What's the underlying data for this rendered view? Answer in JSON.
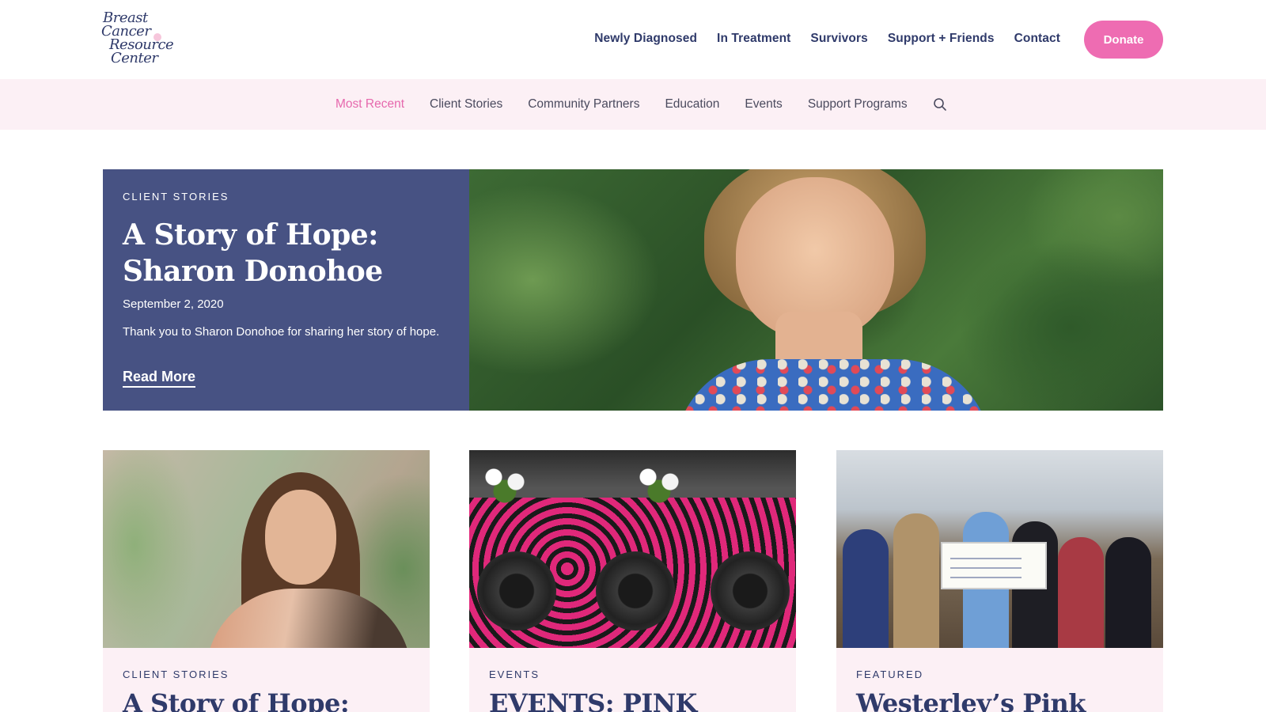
{
  "logo": {
    "lines": [
      "Breast",
      "Cancer",
      "Resource",
      "Center"
    ]
  },
  "main_nav": {
    "items": [
      "Newly Diagnosed",
      "In Treatment",
      "Survivors",
      "Support + Friends",
      "Contact"
    ],
    "donate_label": "Donate"
  },
  "sub_nav": {
    "items": [
      "Most Recent",
      "Client Stories",
      "Community Partners",
      "Education",
      "Events",
      "Support Programs"
    ],
    "active_index": 0,
    "search_icon": "search-icon"
  },
  "hero": {
    "category": "CLIENT STORIES",
    "title": "A Story of Hope: Sharon Donohoe",
    "date": "September 2, 2020",
    "excerpt": "Thank you to Sharon Donohoe for sharing her story of hope.",
    "read_more": "Read More"
  },
  "cards": [
    {
      "category": "CLIENT STORIES",
      "title": "A Story of Hope:"
    },
    {
      "category": "EVENTS",
      "title": "EVENTS: PINK"
    },
    {
      "category": "FEATURED",
      "title": "Westerley’s Pink"
    }
  ],
  "colors": {
    "brand_navy": "#2f3a6a",
    "accent_pink": "#ee6cb2",
    "active_pink": "#e668ad",
    "subnav_bg": "#fcf0f5",
    "hero_panel": "#475283"
  }
}
